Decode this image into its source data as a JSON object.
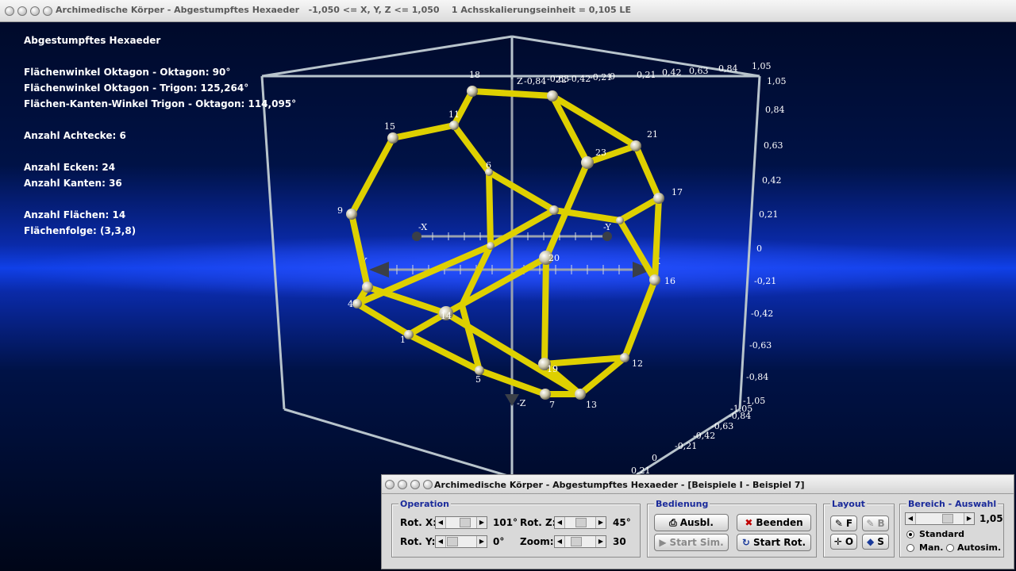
{
  "window": {
    "title": "Archimedische Körper - Abgestumpftes Hexaeder   -1,050 <= X, Y, Z <= 1,050    1 Achsskalierungseinheit = 0,105 LE"
  },
  "info": {
    "heading": "Abgestumpftes Hexaeder",
    "lines": [
      "Flächenwinkel Oktagon - Oktagon: 90°",
      "Flächenwinkel Oktagon - Trigon: 125,264°",
      "Flächen-Kanten-Winkel Trigon - Oktagon: 114,095°",
      "Anzahl Achtecke: 6",
      "Anzahl Ecken: 24",
      "Anzahl Kanten: 36",
      "Anzahl Flächen: 14",
      "Flächenfolge: (3,3,8)"
    ]
  },
  "scene": {
    "axis_labels": {
      "x_pos": "X",
      "x_neg": "-X",
      "y_pos": "Y",
      "y_neg": "-Y",
      "z_pos": "Z",
      "z_neg": "-Z"
    },
    "scale_top": [
      "-0,84",
      "-0,63",
      "-0,42",
      "-0,21",
      "0",
      "0,21",
      "0,42",
      "0,63",
      "0,84",
      "1,05"
    ],
    "scale_right": [
      "1,05",
      "0,84",
      "0,63",
      "0,42",
      "0,21",
      "0",
      "-0,21",
      "-0,42",
      "-0,63",
      "-0,84",
      "-1,05"
    ],
    "scale_bottom": [
      "-1,05",
      "-0,84",
      "-0,63",
      "-0,42",
      "-0,21",
      "0",
      "0,21"
    ],
    "vertex_labels": [
      "1",
      "4",
      "5",
      "6",
      "7",
      "9",
      "11",
      "12",
      "13",
      "14",
      "15",
      "16",
      "17",
      "18",
      "19",
      "20",
      "21",
      "22",
      "23"
    ]
  },
  "panel": {
    "title": "Archimedische Körper - Abgestumpftes Hexaeder - [Beispiele I - Beispiel 7]",
    "operation": {
      "legend": "Operation",
      "rot_x_label": "Rot. X:",
      "rot_x_value": "101°",
      "rot_y_label": "Rot. Y:",
      "rot_y_value": "0°",
      "rot_z_label": "Rot. Z:",
      "rot_z_value": "45°",
      "zoom_label": "Zoom:",
      "zoom_value": "30"
    },
    "bedienung": {
      "legend": "Bedienung",
      "ausbl": "Ausbl.",
      "beenden": "Beenden",
      "start_sim": "Start Sim.",
      "start_rot": "Start Rot."
    },
    "layout": {
      "legend": "Layout",
      "f": "F",
      "b": "B",
      "o": "O",
      "s": "S"
    },
    "bereich": {
      "legend": "Bereich - Auswahl",
      "value": "1,05",
      "standard": "Standard",
      "man": "Man.",
      "autosim": "Autosim."
    }
  },
  "colors": {
    "edge": "#e6d600",
    "frame": "#b8c4cc",
    "legend_blue": "#1a2a9a"
  }
}
